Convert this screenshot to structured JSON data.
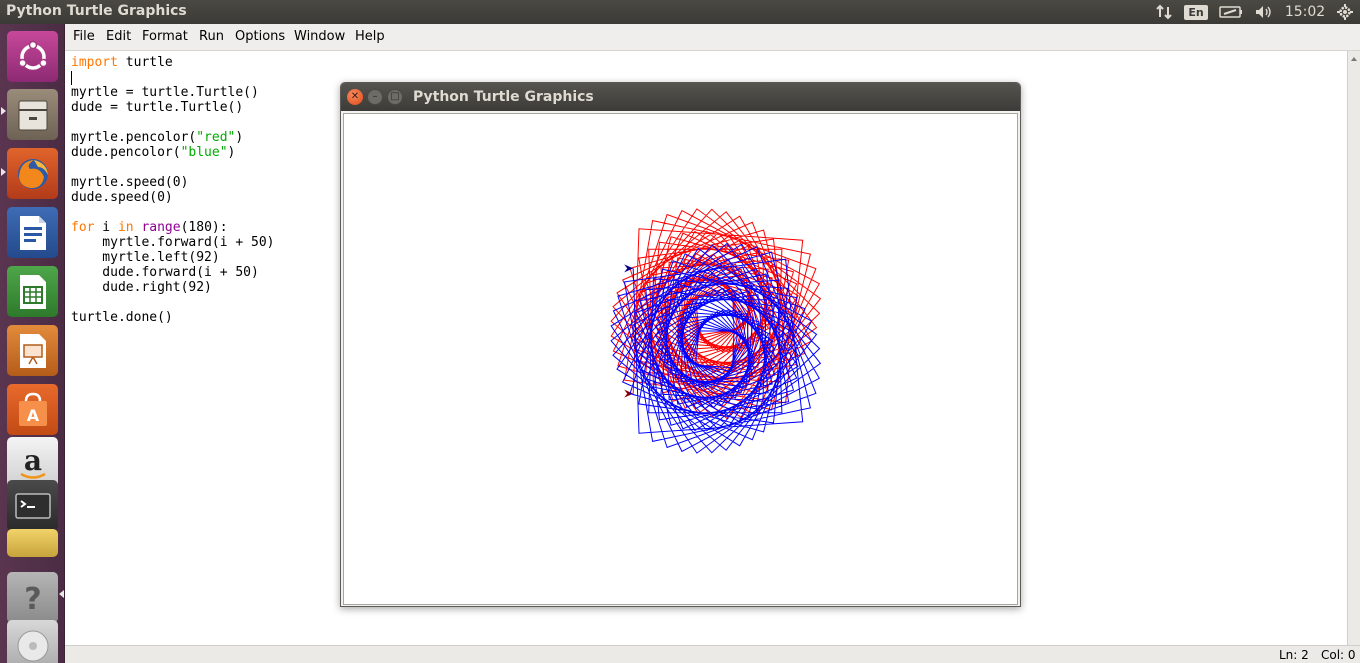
{
  "top_panel": {
    "title": "Python Turtle Graphics",
    "keyboard_layout": "En",
    "clock": "15:02",
    "icons": [
      "network-arrows-icon",
      "battery-icon",
      "volume-icon",
      "gear-icon"
    ]
  },
  "launcher": {
    "items": [
      "ubuntu-dash-icon",
      "files-icon",
      "firefox-icon",
      "libreoffice-writer-icon",
      "libreoffice-calc-icon",
      "libreoffice-impress-icon",
      "ubuntu-software-icon",
      "amazon-icon",
      "terminal-icon",
      "help-icon",
      "dvd-icon"
    ]
  },
  "editor": {
    "menu": [
      "File",
      "Edit",
      "Format",
      "Run",
      "Options",
      "Window",
      "Help"
    ],
    "code": {
      "l1_kw": "import",
      "l1_rest": " turtle",
      "l3": "myrtle = turtle.Turtle()",
      "l4": "dude = turtle.Turtle()",
      "l6_a": "myrtle.pencolor(",
      "l6_s": "\"red\"",
      "l6_b": ")",
      "l7_a": "dude.pencolor(",
      "l7_s": "\"blue\"",
      "l7_b": ")",
      "l9": "myrtle.speed(0)",
      "l10": "dude.speed(0)",
      "l12_for": "for",
      "l12_i": " i ",
      "l12_in": "in",
      "l12_sp": " ",
      "l12_range": "range",
      "l12_rest": "(180):",
      "l13": "    myrtle.forward(i + 50)",
      "l14": "    myrtle.left(92)",
      "l15": "    dude.forward(i + 50)",
      "l16": "    dude.right(92)",
      "l18": "turtle.done()"
    },
    "status": {
      "ln": "Ln: 2",
      "col": "Col: 0"
    }
  },
  "turtle_window": {
    "title": "Python Turtle Graphics",
    "drawing": {
      "iterations": 180,
      "turtle1": {
        "name": "myrtle",
        "color": "#ff0000",
        "turn": "left",
        "angle": 92
      },
      "turtle2": {
        "name": "dude",
        "color": "#0000ff",
        "turn": "right",
        "angle": 92
      }
    }
  },
  "colors": {
    "keyword": "#ff7700",
    "builtin": "#900090",
    "string": "#00aa00",
    "panel": "#3c3b37",
    "launcher": "#4b2c44",
    "close_button": "#df4a16"
  }
}
